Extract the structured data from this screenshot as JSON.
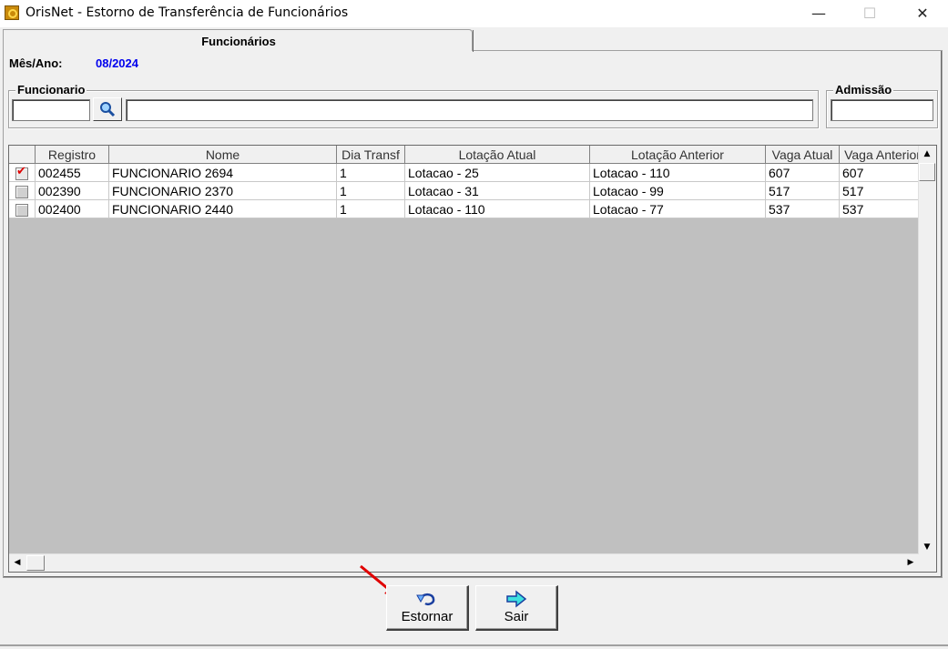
{
  "window": {
    "title": "OrisNet - Estorno de Transferência de Funcionários",
    "minimize": "—",
    "maximize": "☐",
    "close": "✕"
  },
  "tab": {
    "label": "Funcionários"
  },
  "period": {
    "label": "Mês/Ano:",
    "value": "08/2024"
  },
  "filters": {
    "funcionario_legend": "Funcionario",
    "funcionario_code": "",
    "funcionario_name": "",
    "admissao_legend": "Admissão",
    "admissao_value": ""
  },
  "table": {
    "columns": [
      "Registro",
      "Nome",
      "Dia Transf",
      "Lotação Atual",
      "Lotação Anterior",
      "Vaga Atual",
      "Vaga Anterior"
    ],
    "rows": [
      {
        "checked": true,
        "registro": "002455",
        "nome": "FUNCIONARIO 2694",
        "dia": "1",
        "lot_atual": "Lotacao - 25",
        "lot_anterior": "Lotacao - 110",
        "vaga_atual": "607",
        "vaga_anterior": "607"
      },
      {
        "checked": false,
        "registro": "002390",
        "nome": "FUNCIONARIO 2370",
        "dia": "1",
        "lot_atual": "Lotacao - 31",
        "lot_anterior": "Lotacao - 99",
        "vaga_atual": "517",
        "vaga_anterior": "517"
      },
      {
        "checked": false,
        "registro": "002400",
        "nome": "FUNCIONARIO 2440",
        "dia": "1",
        "lot_atual": "Lotacao - 110",
        "lot_anterior": "Lotacao - 77",
        "vaga_atual": "537",
        "vaga_anterior": "537"
      }
    ]
  },
  "buttons": {
    "estornar": {
      "label": "Estornar",
      "icon": "undo-icon"
    },
    "sair": {
      "label": "Sair",
      "icon": "arrow-right-icon"
    }
  },
  "colors": {
    "period_value": "#0000ee",
    "check_mark": "#e00000",
    "pointer_arrow": "#e00000"
  }
}
